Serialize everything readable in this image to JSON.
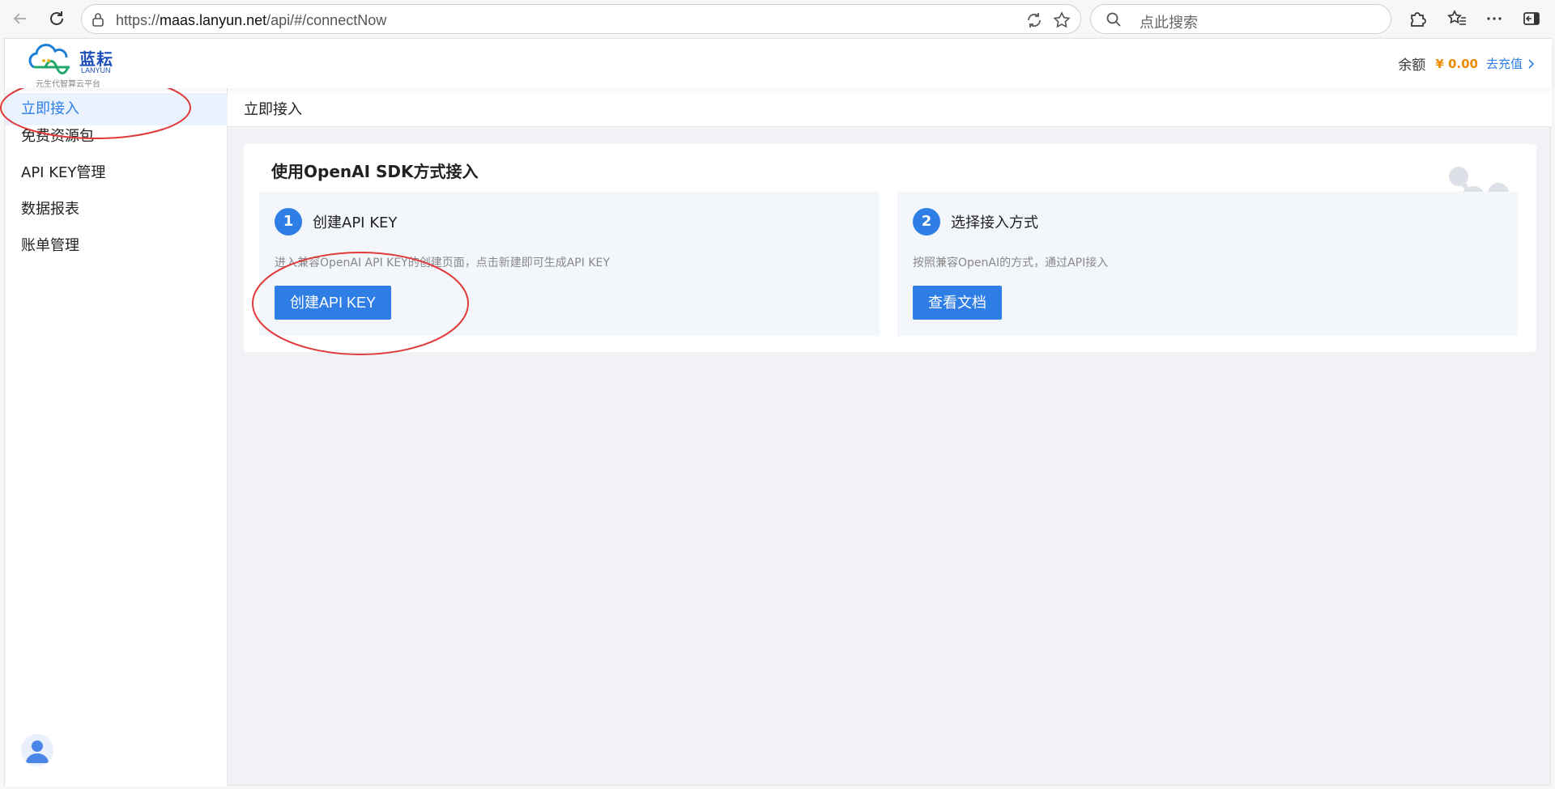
{
  "browser": {
    "url_prefix": "https://",
    "url_host": "maas.lanyun.net",
    "url_path": "/api/#/connectNow",
    "search_placeholder": "点此搜索"
  },
  "header": {
    "logo_cn": "蓝耘",
    "logo_en": "LANYUN",
    "logo_slogan": "元生代智算云平台",
    "balance_label": "余额",
    "balance_amount": "¥ 0.00",
    "recharge_label": "去充值"
  },
  "sidebar": {
    "items": [
      {
        "label": "立即接入",
        "active": true
      },
      {
        "label": "免费资源包"
      },
      {
        "label": "API KEY管理"
      },
      {
        "label": "数据报表"
      },
      {
        "label": "账单管理"
      }
    ]
  },
  "breadcrumb": "立即接入",
  "card": {
    "title": "使用OpenAI SDK方式接入",
    "steps": [
      {
        "num": "1",
        "title": "创建API KEY",
        "desc": "进入兼容OpenAI API KEY的创建页面，点击新建即可生成API KEY",
        "button": "创建API KEY"
      },
      {
        "num": "2",
        "title": "选择接入方式",
        "desc": "按照兼容OpenAI的方式，通过API接入",
        "button": "查看文档"
      }
    ]
  },
  "colors": {
    "accent": "#2f7ee6",
    "balance": "#f08a00",
    "annotation": "#e03a3a"
  }
}
